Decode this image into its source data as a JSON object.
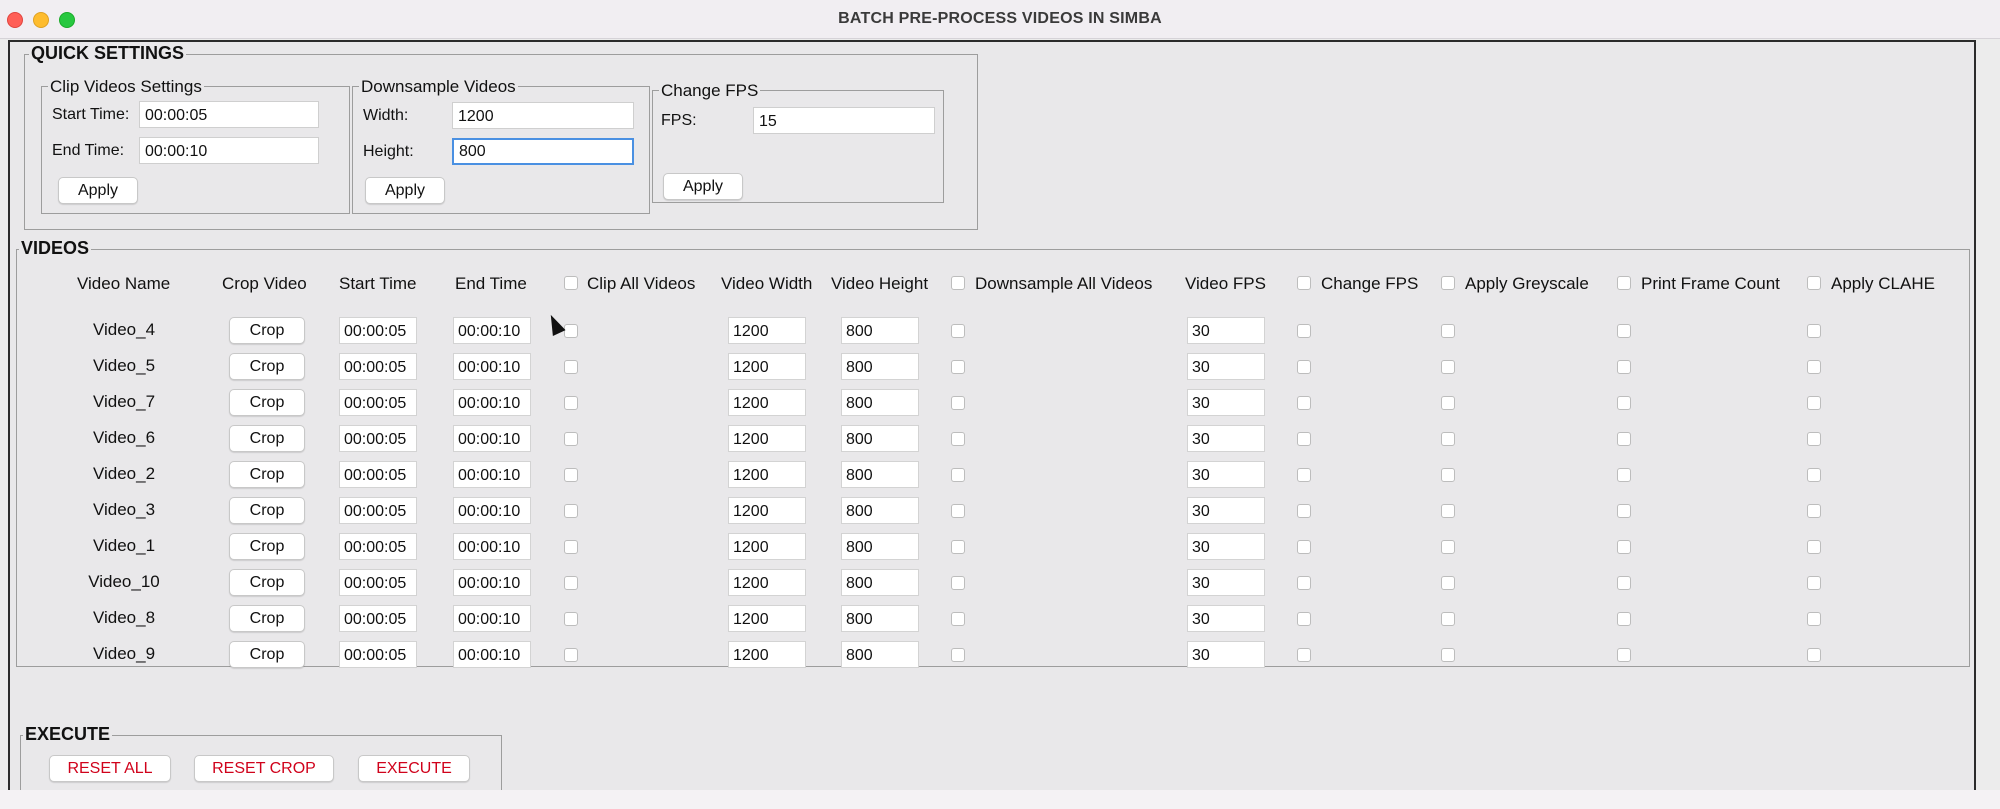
{
  "window": {
    "title": "BATCH PRE-PROCESS VIDEOS IN SIMBA"
  },
  "quick_settings": {
    "title": "QUICK SETTINGS",
    "clip": {
      "title": "Clip Videos Settings",
      "start_label": "Start Time:",
      "start_value": "00:00:05",
      "end_label": "End Time:",
      "end_value": "00:00:10",
      "apply_label": "Apply"
    },
    "downsample": {
      "title": "Downsample Videos",
      "width_label": "Width:",
      "width_value": "1200",
      "height_label": "Height:",
      "height_value": "800",
      "apply_label": "Apply"
    },
    "fps": {
      "title": "Change FPS",
      "fps_label": "FPS:",
      "fps_value": "15",
      "apply_label": "Apply"
    }
  },
  "videos": {
    "title": "VIDEOS",
    "headers": {
      "video_name": "Video Name",
      "crop_video": "Crop Video",
      "start_time": "Start Time",
      "end_time": "End Time",
      "clip_all": "Clip All Videos",
      "video_width": "Video Width",
      "video_height": "Video Height",
      "downsample_all": "Downsample All Videos",
      "video_fps": "Video FPS",
      "change_fps": "Change FPS",
      "apply_greyscale": "Apply Greyscale",
      "print_frame_count": "Print Frame Count",
      "apply_clahe": "Apply CLAHE"
    },
    "crop_label": "Crop",
    "rows": [
      {
        "name": "Video_4",
        "start": "00:00:05",
        "end": "00:00:10",
        "width": "1200",
        "height": "800",
        "fps": "30"
      },
      {
        "name": "Video_5",
        "start": "00:00:05",
        "end": "00:00:10",
        "width": "1200",
        "height": "800",
        "fps": "30"
      },
      {
        "name": "Video_7",
        "start": "00:00:05",
        "end": "00:00:10",
        "width": "1200",
        "height": "800",
        "fps": "30"
      },
      {
        "name": "Video_6",
        "start": "00:00:05",
        "end": "00:00:10",
        "width": "1200",
        "height": "800",
        "fps": "30"
      },
      {
        "name": "Video_2",
        "start": "00:00:05",
        "end": "00:00:10",
        "width": "1200",
        "height": "800",
        "fps": "30"
      },
      {
        "name": "Video_3",
        "start": "00:00:05",
        "end": "00:00:10",
        "width": "1200",
        "height": "800",
        "fps": "30"
      },
      {
        "name": "Video_1",
        "start": "00:00:05",
        "end": "00:00:10",
        "width": "1200",
        "height": "800",
        "fps": "30"
      },
      {
        "name": "Video_10",
        "start": "00:00:05",
        "end": "00:00:10",
        "width": "1200",
        "height": "800",
        "fps": "30"
      },
      {
        "name": "Video_8",
        "start": "00:00:05",
        "end": "00:00:10",
        "width": "1200",
        "height": "800",
        "fps": "30"
      },
      {
        "name": "Video_9",
        "start": "00:00:05",
        "end": "00:00:10",
        "width": "1200",
        "height": "800",
        "fps": "30"
      }
    ]
  },
  "execute": {
    "title": "EXECUTE",
    "reset_all_label": "RESET ALL",
    "reset_crop_label": "RESET CROP",
    "execute_label": "EXECUTE",
    "button_text_color": "#d0021b"
  }
}
